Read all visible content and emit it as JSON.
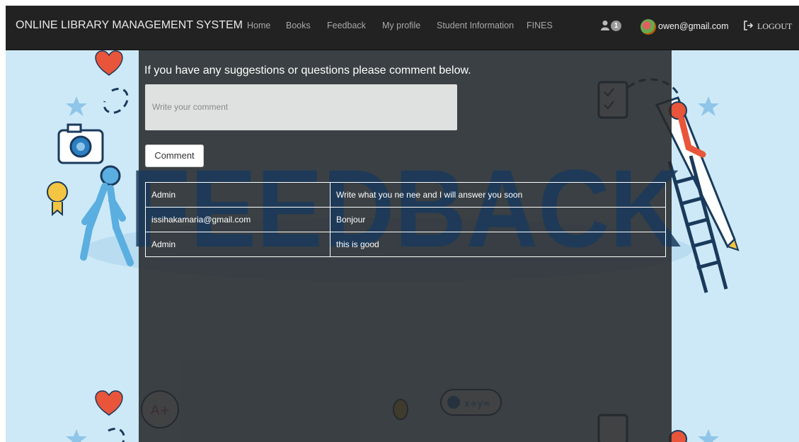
{
  "navbar": {
    "brand": "ONLINE LIBRARY MANAGEMENT SYSTEM",
    "links": [
      "Home",
      "Books",
      "Feedback",
      "My profile",
      "Student Information",
      "FINES"
    ],
    "notification_count": "1",
    "user_email": "owen@gmail.com",
    "logout_label": "LOGOUT"
  },
  "feedback": {
    "prompt": "If you have any suggestions or questions please comment below.",
    "comment_placeholder": "Write your comment",
    "comment_button": "Comment",
    "watermark": "FEEDBACK",
    "rows": [
      {
        "user": "Admin",
        "comment": "Write what you ne nee and I will answer you soon"
      },
      {
        "user": "issihakamaria@gmail.com",
        "comment": "Bonjour"
      },
      {
        "user": "Admin",
        "comment": "this is good"
      }
    ]
  },
  "colors": {
    "navbar_bg": "#222222",
    "page_bg": "#cde9f7",
    "panel_bg": "#26282a",
    "watermark": "#1a3a5c"
  },
  "icons": [
    "user-icon",
    "avatar-image",
    "logout-icon"
  ]
}
